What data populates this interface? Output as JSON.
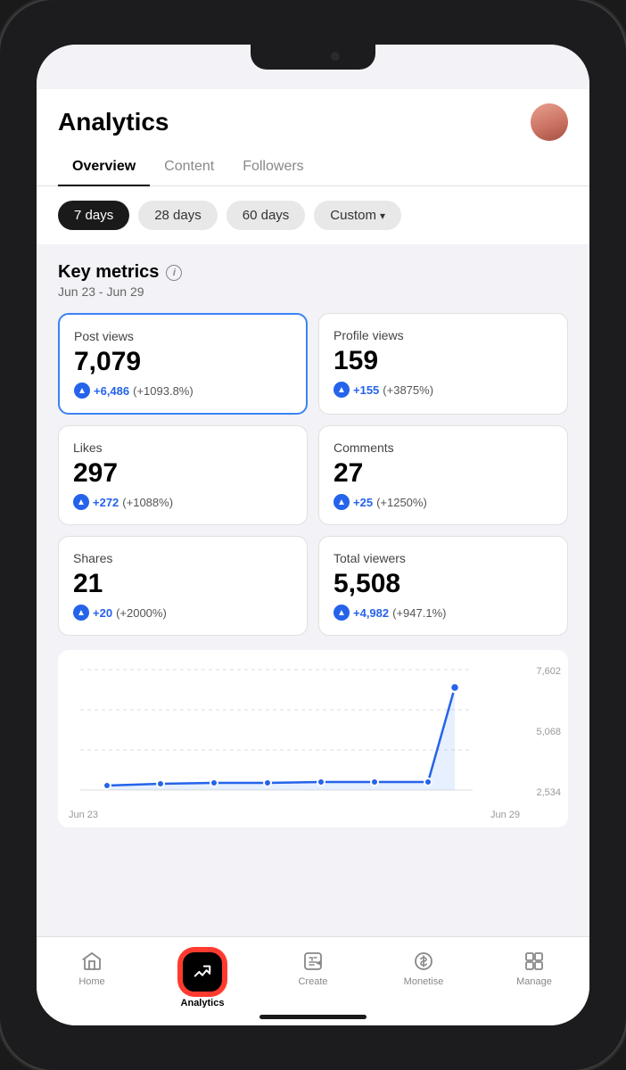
{
  "header": {
    "title": "Analytics",
    "avatar_alt": "User avatar"
  },
  "tabs": {
    "items": [
      {
        "label": "Overview",
        "active": true
      },
      {
        "label": "Content",
        "active": false
      },
      {
        "label": "Followers",
        "active": false
      }
    ]
  },
  "filters": {
    "items": [
      {
        "label": "7 days",
        "active": true
      },
      {
        "label": "28 days",
        "active": false
      },
      {
        "label": "60 days",
        "active": false
      },
      {
        "label": "Custom",
        "active": false,
        "has_chevron": true
      }
    ]
  },
  "metrics": {
    "section_title": "Key metrics",
    "date_range": "Jun 23 - Jun 29",
    "cards": [
      {
        "label": "Post views",
        "value": "7,079",
        "change": "+6,486",
        "change_pct": "(+1093.8%)",
        "highlighted": true
      },
      {
        "label": "Profile views",
        "value": "159",
        "change": "+155",
        "change_pct": "(+3875%)",
        "highlighted": false
      },
      {
        "label": "Likes",
        "value": "297",
        "change": "+272",
        "change_pct": "(+1088%)",
        "highlighted": false
      },
      {
        "label": "Comments",
        "value": "27",
        "change": "+25",
        "change_pct": "(+1250%)",
        "highlighted": false
      },
      {
        "label": "Shares",
        "value": "21",
        "change": "+20",
        "change_pct": "(+2000%)",
        "highlighted": false
      },
      {
        "label": "Total viewers",
        "value": "5,508",
        "change": "+4,982",
        "change_pct": "(+947.1%)",
        "highlighted": false
      }
    ]
  },
  "chart": {
    "y_labels": [
      "7,602",
      "5,068",
      "2,534"
    ],
    "x_labels": [
      "Jun 23",
      "Jun 29"
    ]
  },
  "bottom_nav": {
    "items": [
      {
        "label": "Home",
        "icon": "home-icon",
        "active": false
      },
      {
        "label": "Analytics",
        "icon": "analytics-icon",
        "active": true
      },
      {
        "label": "Create",
        "icon": "create-icon",
        "active": false
      },
      {
        "label": "Monetise",
        "icon": "monetise-icon",
        "active": false
      },
      {
        "label": "Manage",
        "icon": "manage-icon",
        "active": false
      }
    ]
  }
}
